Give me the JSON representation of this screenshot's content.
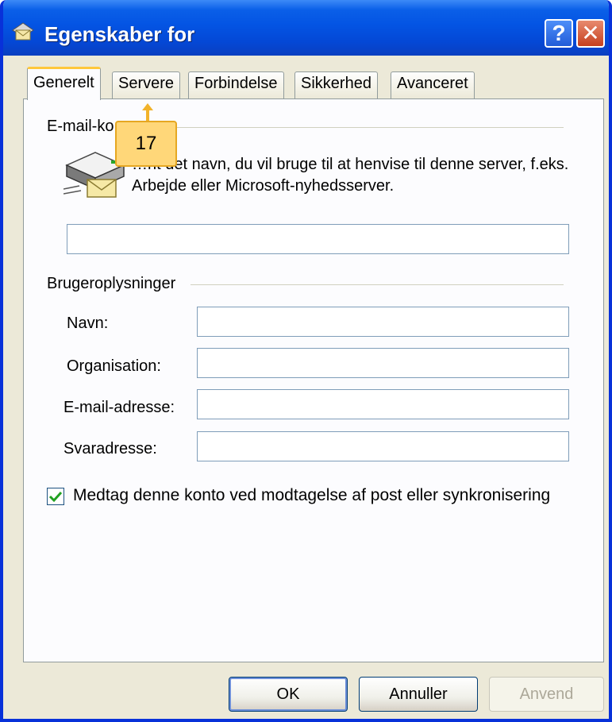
{
  "window": {
    "title": "Egenskaber for"
  },
  "titlebar_buttons": {
    "help": "?",
    "close": "✕"
  },
  "tabs": [
    {
      "label": "Generelt",
      "active": true
    },
    {
      "label": "Servere",
      "active": false
    },
    {
      "label": "Forbindelse",
      "active": false
    },
    {
      "label": "Sikkerhed",
      "active": false
    },
    {
      "label": "Avanceret",
      "active": false
    }
  ],
  "mail_account": {
    "group_label": "E-mail-ko",
    "description": "…nt det navn, du vil bruge til at henvise til denne server, f.eks. Arbejde eller Microsoft-nyhedsserver.",
    "account_name_value": ""
  },
  "user_info": {
    "group_label": "Brugeroplysninger",
    "fields": [
      {
        "label": "Navn:",
        "value": ""
      },
      {
        "label": "Organisation:",
        "value": ""
      },
      {
        "label": "E-mail-adresse:",
        "value": ""
      },
      {
        "label": "Svaradresse:",
        "value": ""
      }
    ]
  },
  "include_checkbox": {
    "label": "Medtag denne konto ved modtagelse af post eller synkronisering",
    "checked": true
  },
  "buttons": {
    "ok": "OK",
    "cancel": "Annuller",
    "apply": "Anvend"
  },
  "callout": {
    "number": "17"
  },
  "colors": {
    "titlebar": "#0454e3",
    "tab_highlight": "#ffc83c",
    "callout": "#ffd779",
    "checkmark": "#21a121"
  }
}
